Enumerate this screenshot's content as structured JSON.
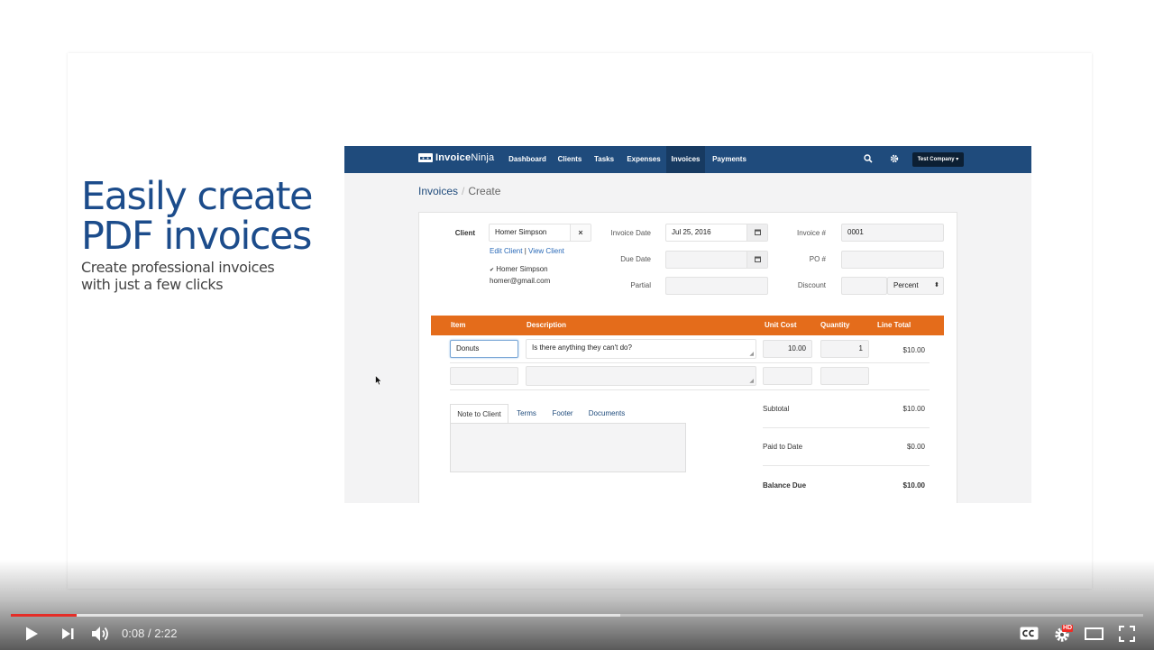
{
  "slide": {
    "headline_line1": "Easily create",
    "headline_line2": "PDF invoices",
    "subhead_line1": "Create professional invoices",
    "subhead_line2": "with just a few clicks"
  },
  "app": {
    "brand": "InvoiceNinja",
    "brand_part1": "Invoice",
    "brand_part2": "Ninja",
    "nav": [
      "Dashboard",
      "Clients",
      "Tasks",
      "Expenses",
      "Invoices",
      "Payments"
    ],
    "active_nav": "Invoices",
    "company_menu": "Test Company ▾",
    "breadcrumb": {
      "parent": "Invoices",
      "separator": "/",
      "current": "Create"
    },
    "form": {
      "client_label": "Client",
      "client_value": "Homer Simpson",
      "client_clear": "×",
      "edit_client": "Edit Client",
      "link_sep": "|",
      "view_client": "View Client",
      "contact_check": "✔",
      "contact_name": "Homer Simpson",
      "contact_email": "homer@gmail.com",
      "invoice_date_label": "Invoice Date",
      "invoice_date_value": "Jul 25, 2016",
      "due_date_label": "Due Date",
      "due_date_value": "",
      "partial_label": "Partial",
      "partial_value": "",
      "invoice_num_label": "Invoice #",
      "invoice_num_value": "0001",
      "po_label": "PO #",
      "po_value": "",
      "discount_label": "Discount",
      "discount_value": "",
      "discount_type": "Percent",
      "select_arrows": "⬍",
      "calendar_icon": "calendar-icon"
    },
    "items": {
      "headers": {
        "item": "Item",
        "description": "Description",
        "unit_cost": "Unit Cost",
        "quantity": "Quantity",
        "line_total": "Line Total"
      },
      "rows": [
        {
          "item": "Donuts",
          "description": "Is there anything they can't do?",
          "unit_cost": "10.00",
          "quantity": "1",
          "line_total": "$10.00"
        },
        {
          "item": "",
          "description": "",
          "unit_cost": "",
          "quantity": "",
          "line_total": ""
        }
      ],
      "resize_glyph": "◢"
    },
    "tabs": [
      "Note to Client",
      "Terms",
      "Footer",
      "Documents"
    ],
    "active_tab": "Note to Client",
    "totals": {
      "subtotal_label": "Subtotal",
      "subtotal_value": "$10.00",
      "paid_label": "Paid to Date",
      "paid_value": "$0.00",
      "balance_label": "Balance Due",
      "balance_value": "$10.00"
    }
  },
  "player": {
    "current_time": "0:08",
    "separator": "/",
    "duration": "2:22",
    "time_display": "0:08 / 2:22",
    "played_fraction": 0.058,
    "loaded_fraction": 0.538,
    "hd_badge": "HD",
    "accent_color": "#e52d27"
  },
  "colors": {
    "brand_navy": "#1f4b7c",
    "header_orange": "#e46c1b",
    "headline_blue": "#1c4c8b"
  }
}
